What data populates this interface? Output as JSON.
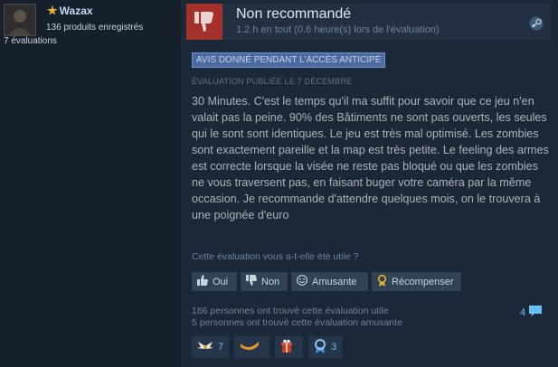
{
  "author": {
    "name": "Wazax",
    "products": "136 produits enregistrés",
    "reviews": "7 évaluations"
  },
  "vote": {
    "title": "Non recommandé",
    "hours": "1.2 h en tout (0.6 heure(s) lors de l'évaluation)"
  },
  "early_access": "AVIS DONNÉ PENDANT L'ACCÈS ANTICIPÉ",
  "posted": "ÉVALUATION PUBLIÉE LE 7 DÉCEMBRE",
  "review_text": "30 Minutes. C'est le temps qu'il ma suffit pour savoir que ce jeu n'en valait pas la peine. 90% des Bâtiments ne sont pas ouverts, les seules qui le sont sont identiques. Le jeu est très mal optimisé. Les zombies sont exactement pareille et la map est très petite. Le feeling des armes est correcte lorsque la visée ne reste pas bloqué ou que les zombies ne vous traversent pas, en faisant buger votre caméra par la même occasion. Je recommande d'attendre quelques mois, on le trouvera à une poignée d'euro",
  "question": "Cette évaluation vous a-t-elle été utile ?",
  "buttons": {
    "yes": "Oui",
    "no": "Non",
    "funny": "Amusante",
    "award": "Récompenser"
  },
  "stats": {
    "helpful": "186 personnes ont trouvé cette évaluation utile",
    "funny": "5 personnes ont trouvé cette évaluation amusante"
  },
  "comments_count": "4",
  "awards": [
    {
      "icon": "wings-award-icon",
      "count": "7"
    },
    {
      "icon": "boomerang-award-icon",
      "count": ""
    },
    {
      "icon": "gift-award-icon",
      "count": ""
    },
    {
      "icon": "medal-award-icon",
      "count": "3"
    }
  ],
  "colors": {
    "background": "#1b2838",
    "thumb_down": "#a3302a",
    "accent": "#66c0f4",
    "early_access": "#4b6aa1"
  }
}
